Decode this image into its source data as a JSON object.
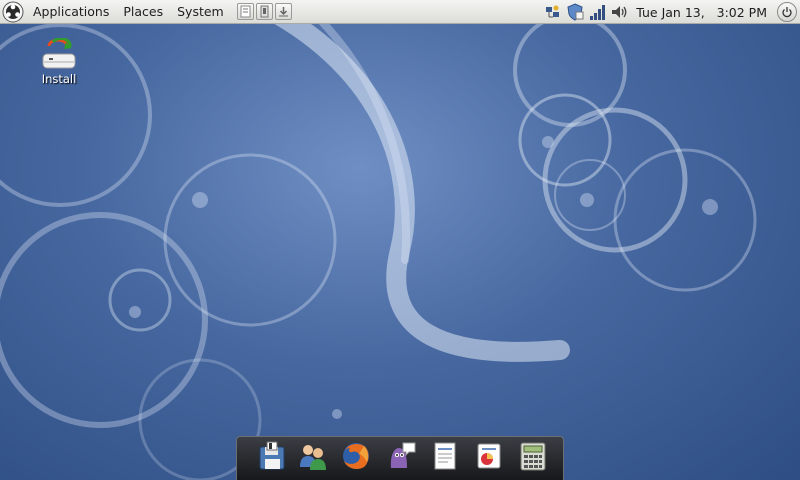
{
  "top_panel": {
    "menus": [
      "Applications",
      "Places",
      "System"
    ],
    "launchers": [
      "text-editor-launcher",
      "notes-launcher",
      "downloads-launcher"
    ],
    "tray_icons": [
      "network-icon",
      "security-shield-icon",
      "signal-strength-icon",
      "volume-icon"
    ],
    "clock": "Tue Jan 13,   3:02 PM"
  },
  "desktop": {
    "icons": [
      {
        "label": "Install",
        "icon": "installer-drive-icon"
      }
    ]
  },
  "dock": {
    "items": [
      {
        "name": "save-app",
        "icon": "floppy-disk-icon"
      },
      {
        "name": "contacts-app",
        "icon": "people-icon"
      },
      {
        "name": "firefox-app",
        "icon": "firefox-icon"
      },
      {
        "name": "pidgin-app",
        "icon": "pidgin-chat-icon"
      },
      {
        "name": "office-writer-app",
        "icon": "document-icon"
      },
      {
        "name": "office-impress-app",
        "icon": "presentation-icon"
      },
      {
        "name": "calculator-app",
        "icon": "calculator-icon"
      }
    ]
  },
  "colors": {
    "wallpaper_base": "#46679f",
    "panel_bg": "#e8e8e5",
    "dock_bg": "#2a2c30"
  }
}
